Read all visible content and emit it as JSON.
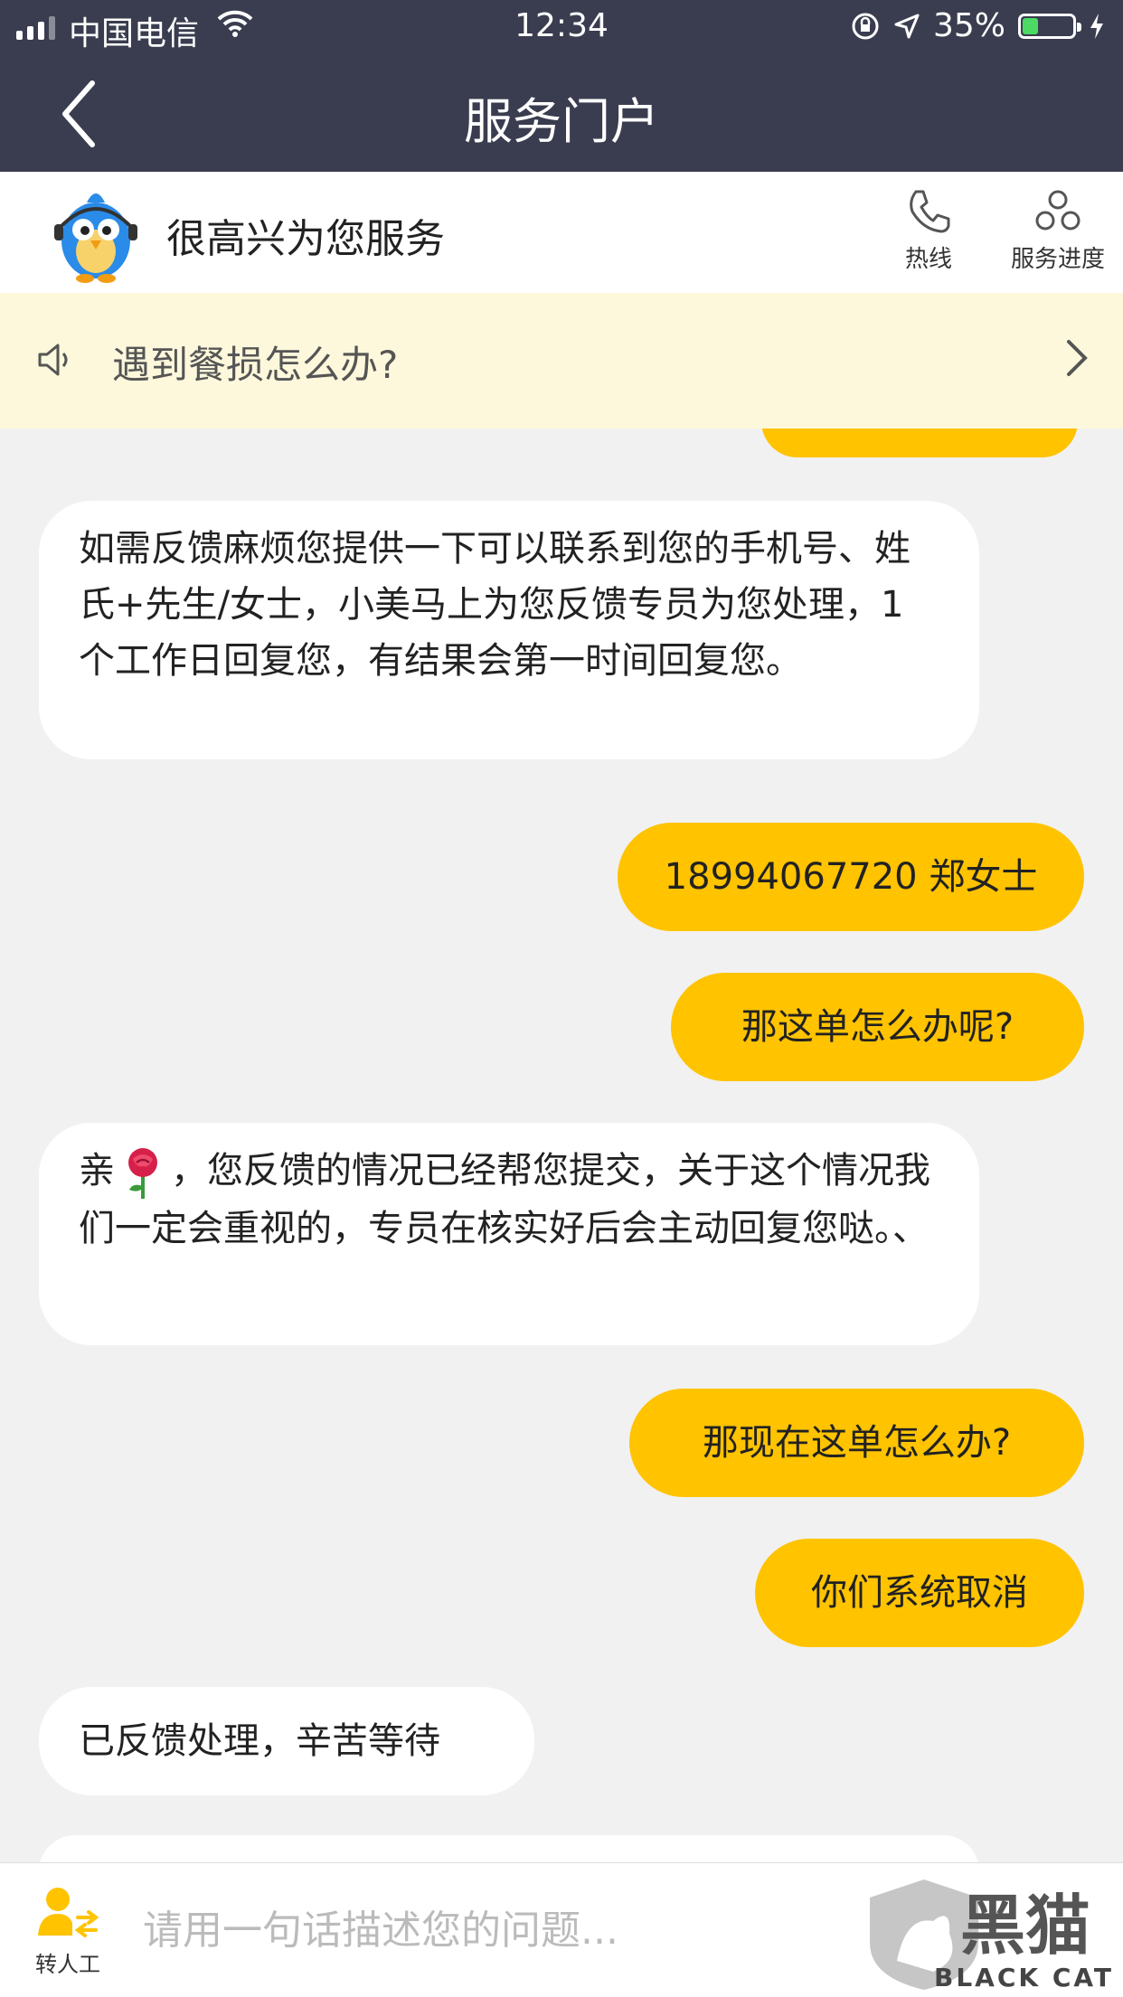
{
  "status_bar": {
    "carrier": "中国电信",
    "time": "12:34",
    "battery": "35%",
    "battery_level": 0.35
  },
  "nav": {
    "title": "服务门户"
  },
  "header": {
    "greeting": "很高兴为您服务",
    "hotline_label": "热线",
    "progress_label": "服务进度"
  },
  "notice": {
    "text": "遇到餐损怎么办?"
  },
  "messages": [
    {
      "side": "right",
      "text": ""
    },
    {
      "side": "left",
      "text": " 如需反馈麻烦您提供一下可以联系到您的手机号、姓氏+先生/女士，小美马上为您反馈专员为您处理，1个工作日回复您，有结果会第一时间回复您。"
    },
    {
      "side": "right",
      "text": "18994067720 郑女士"
    },
    {
      "side": "right",
      "text": "那这单怎么办呢?"
    },
    {
      "side": "left",
      "text_before": "亲",
      "text_after": "，您反馈的情况已经帮您提交，关于这个情况我们一定会重视的，专员在核实好后会主动回复您哒。、"
    },
    {
      "side": "right",
      "text": "那现在这单怎么办?"
    },
    {
      "side": "right",
      "text": "你们系统取消"
    },
    {
      "side": "left",
      "text": "已反馈处理，辛苦等待"
    }
  ],
  "bottom": {
    "agent_label": "转人工",
    "input_placeholder": "请用一句话描述您的问题...",
    "watermark_text": "BLACK CAT",
    "watermark_brand": "黑猫"
  },
  "colors": {
    "nav_bg": "#3a3d4f",
    "user_bubble": "#ffc300",
    "notice_bg": "#fdf8dc",
    "chat_bg": "#f1f1f1"
  }
}
